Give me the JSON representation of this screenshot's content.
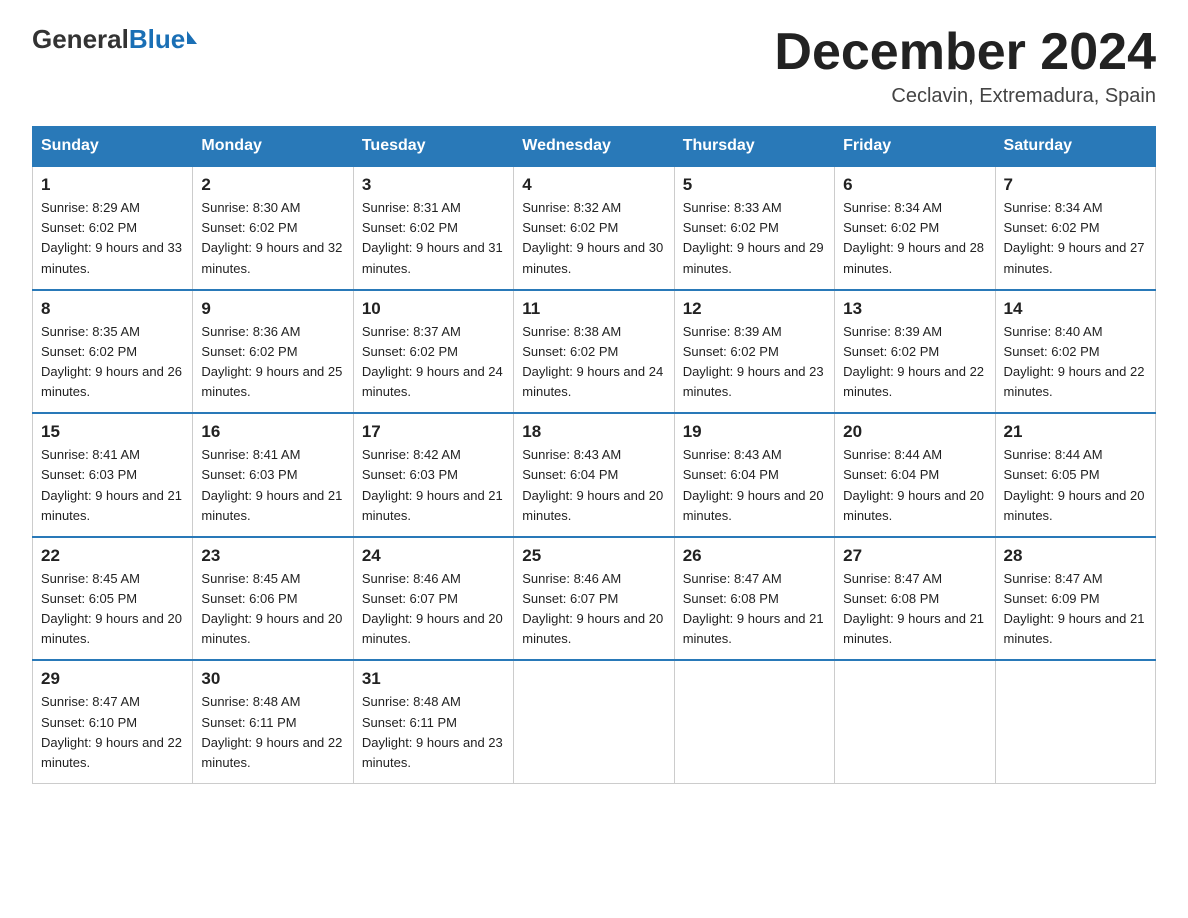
{
  "logo": {
    "general": "General",
    "blue": "Blue"
  },
  "title": "December 2024",
  "subtitle": "Ceclavin, Extremadura, Spain",
  "days_of_week": [
    "Sunday",
    "Monday",
    "Tuesday",
    "Wednesday",
    "Thursday",
    "Friday",
    "Saturday"
  ],
  "weeks": [
    [
      {
        "num": "1",
        "sunrise": "8:29 AM",
        "sunset": "6:02 PM",
        "daylight": "9 hours and 33 minutes."
      },
      {
        "num": "2",
        "sunrise": "8:30 AM",
        "sunset": "6:02 PM",
        "daylight": "9 hours and 32 minutes."
      },
      {
        "num": "3",
        "sunrise": "8:31 AM",
        "sunset": "6:02 PM",
        "daylight": "9 hours and 31 minutes."
      },
      {
        "num": "4",
        "sunrise": "8:32 AM",
        "sunset": "6:02 PM",
        "daylight": "9 hours and 30 minutes."
      },
      {
        "num": "5",
        "sunrise": "8:33 AM",
        "sunset": "6:02 PM",
        "daylight": "9 hours and 29 minutes."
      },
      {
        "num": "6",
        "sunrise": "8:34 AM",
        "sunset": "6:02 PM",
        "daylight": "9 hours and 28 minutes."
      },
      {
        "num": "7",
        "sunrise": "8:34 AM",
        "sunset": "6:02 PM",
        "daylight": "9 hours and 27 minutes."
      }
    ],
    [
      {
        "num": "8",
        "sunrise": "8:35 AM",
        "sunset": "6:02 PM",
        "daylight": "9 hours and 26 minutes."
      },
      {
        "num": "9",
        "sunrise": "8:36 AM",
        "sunset": "6:02 PM",
        "daylight": "9 hours and 25 minutes."
      },
      {
        "num": "10",
        "sunrise": "8:37 AM",
        "sunset": "6:02 PM",
        "daylight": "9 hours and 24 minutes."
      },
      {
        "num": "11",
        "sunrise": "8:38 AM",
        "sunset": "6:02 PM",
        "daylight": "9 hours and 24 minutes."
      },
      {
        "num": "12",
        "sunrise": "8:39 AM",
        "sunset": "6:02 PM",
        "daylight": "9 hours and 23 minutes."
      },
      {
        "num": "13",
        "sunrise": "8:39 AM",
        "sunset": "6:02 PM",
        "daylight": "9 hours and 22 minutes."
      },
      {
        "num": "14",
        "sunrise": "8:40 AM",
        "sunset": "6:02 PM",
        "daylight": "9 hours and 22 minutes."
      }
    ],
    [
      {
        "num": "15",
        "sunrise": "8:41 AM",
        "sunset": "6:03 PM",
        "daylight": "9 hours and 21 minutes."
      },
      {
        "num": "16",
        "sunrise": "8:41 AM",
        "sunset": "6:03 PM",
        "daylight": "9 hours and 21 minutes."
      },
      {
        "num": "17",
        "sunrise": "8:42 AM",
        "sunset": "6:03 PM",
        "daylight": "9 hours and 21 minutes."
      },
      {
        "num": "18",
        "sunrise": "8:43 AM",
        "sunset": "6:04 PM",
        "daylight": "9 hours and 20 minutes."
      },
      {
        "num": "19",
        "sunrise": "8:43 AM",
        "sunset": "6:04 PM",
        "daylight": "9 hours and 20 minutes."
      },
      {
        "num": "20",
        "sunrise": "8:44 AM",
        "sunset": "6:04 PM",
        "daylight": "9 hours and 20 minutes."
      },
      {
        "num": "21",
        "sunrise": "8:44 AM",
        "sunset": "6:05 PM",
        "daylight": "9 hours and 20 minutes."
      }
    ],
    [
      {
        "num": "22",
        "sunrise": "8:45 AM",
        "sunset": "6:05 PM",
        "daylight": "9 hours and 20 minutes."
      },
      {
        "num": "23",
        "sunrise": "8:45 AM",
        "sunset": "6:06 PM",
        "daylight": "9 hours and 20 minutes."
      },
      {
        "num": "24",
        "sunrise": "8:46 AM",
        "sunset": "6:07 PM",
        "daylight": "9 hours and 20 minutes."
      },
      {
        "num": "25",
        "sunrise": "8:46 AM",
        "sunset": "6:07 PM",
        "daylight": "9 hours and 20 minutes."
      },
      {
        "num": "26",
        "sunrise": "8:47 AM",
        "sunset": "6:08 PM",
        "daylight": "9 hours and 21 minutes."
      },
      {
        "num": "27",
        "sunrise": "8:47 AM",
        "sunset": "6:08 PM",
        "daylight": "9 hours and 21 minutes."
      },
      {
        "num": "28",
        "sunrise": "8:47 AM",
        "sunset": "6:09 PM",
        "daylight": "9 hours and 21 minutes."
      }
    ],
    [
      {
        "num": "29",
        "sunrise": "8:47 AM",
        "sunset": "6:10 PM",
        "daylight": "9 hours and 22 minutes."
      },
      {
        "num": "30",
        "sunrise": "8:48 AM",
        "sunset": "6:11 PM",
        "daylight": "9 hours and 22 minutes."
      },
      {
        "num": "31",
        "sunrise": "8:48 AM",
        "sunset": "6:11 PM",
        "daylight": "9 hours and 23 minutes."
      },
      null,
      null,
      null,
      null
    ]
  ]
}
